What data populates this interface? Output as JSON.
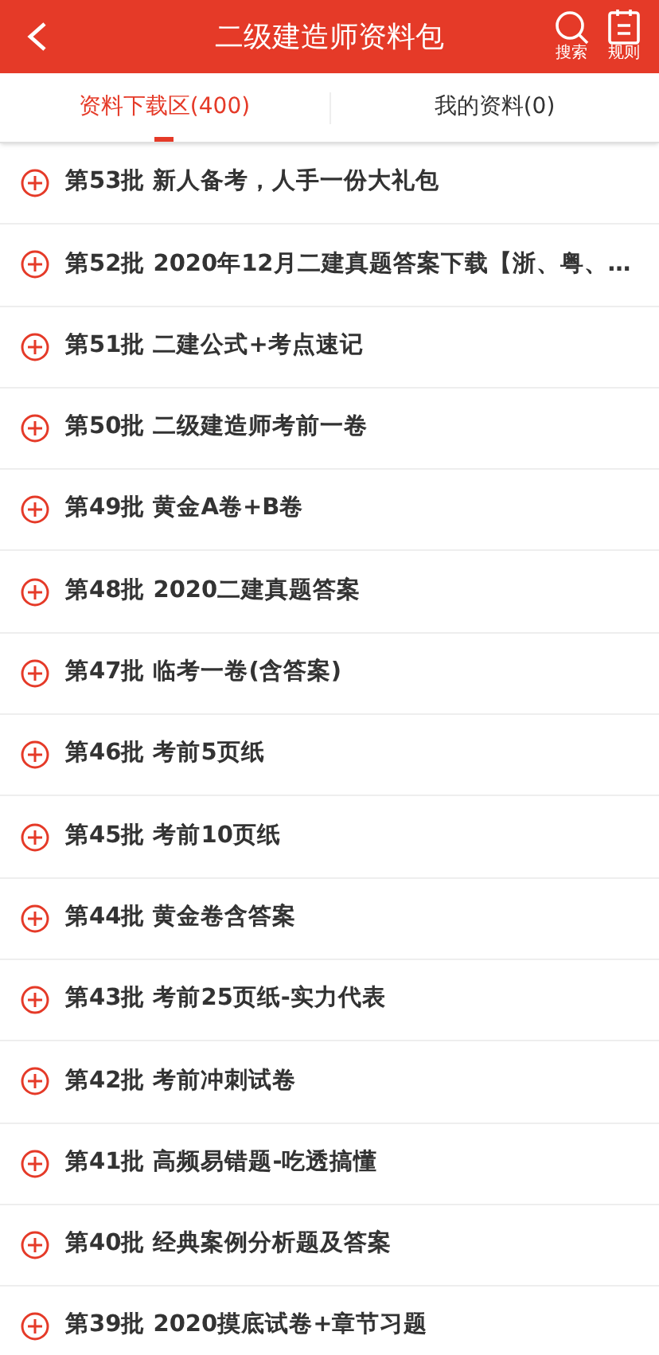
{
  "header": {
    "title": "二级建造师资料包",
    "actions": [
      {
        "kind": "search",
        "label": "搜索"
      },
      {
        "kind": "rules",
        "label": "规则"
      }
    ]
  },
  "tabs": [
    {
      "label": "资料下载区(400)",
      "selected": true
    },
    {
      "label": "我的资料(0)",
      "selected": false
    }
  ],
  "items": [
    {
      "title": "第53批 新人备考，人手一份大礼包"
    },
    {
      "title": "第52批 2020年12月二建真题答案下载【浙、粤、…"
    },
    {
      "title": "第51批 二建公式+考点速记"
    },
    {
      "title": "第50批 二级建造师考前一卷"
    },
    {
      "title": "第49批 黄金A卷+B卷"
    },
    {
      "title": "第48批 2020二建真题答案"
    },
    {
      "title": "第47批 临考一卷(含答案)"
    },
    {
      "title": "第46批 考前5页纸"
    },
    {
      "title": "第45批 考前10页纸"
    },
    {
      "title": "第44批 黄金卷含答案"
    },
    {
      "title": "第43批 考前25页纸-实力代表"
    },
    {
      "title": "第42批 考前冲刺试卷"
    },
    {
      "title": "第41批 高频易错题-吃透搞懂"
    },
    {
      "title": "第40批 经典案例分析题及答案"
    },
    {
      "title": "第39批 2020摸底试卷+章节习题"
    }
  ]
}
